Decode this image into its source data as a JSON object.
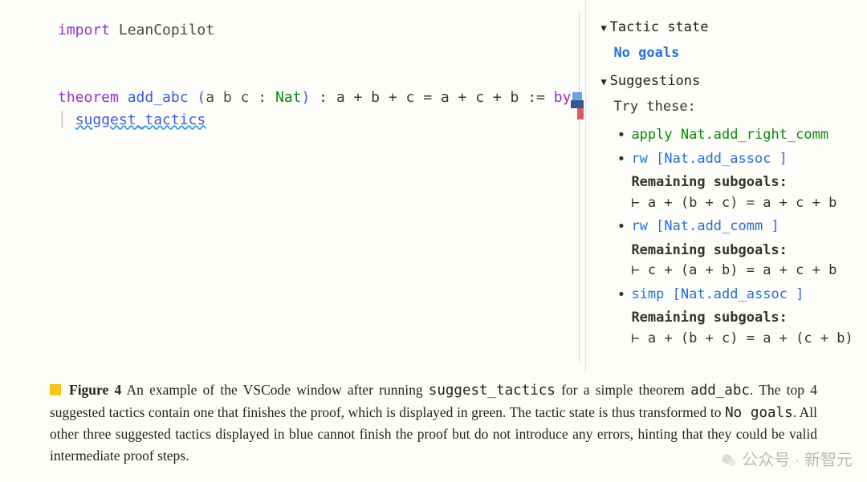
{
  "editor": {
    "line1": {
      "kw": "import",
      "module": "LeanCopilot"
    },
    "line2": {
      "kw": "theorem",
      "name": "add_abc",
      "params_open": "(",
      "params": "a b c",
      "colon1": " : ",
      "type": "Nat",
      "params_close": ")",
      "sig": " : a + b + c = a + c + b := ",
      "by": "by"
    },
    "line3": {
      "bar": "│ ",
      "tactic": "suggest_tactics"
    }
  },
  "sidebar": {
    "tactic_state_title": "Tactic state",
    "no_goals": "No goals",
    "suggestions_title": "Suggestions",
    "try_these": "Try these:",
    "suggestions": [
      {
        "tactic_apply": "apply",
        "tactic_args": "  Nat.add_right_comm",
        "kind": "green"
      },
      {
        "tactic_apply": "rw",
        "tactic_args": " [Nat.add_assoc ]",
        "kind": "blue",
        "subhead": "Remaining subgoals:",
        "subgoal": "⊢ a + (b + c) = a + c + b"
      },
      {
        "tactic_apply": "rw",
        "tactic_args": " [Nat.add_comm ]",
        "kind": "blue",
        "subhead": "Remaining subgoals:",
        "subgoal": "⊢ c + (a + b) = a + c + b"
      },
      {
        "tactic_apply": "simp",
        "tactic_args": " [Nat.add_assoc ]",
        "kind": "blue",
        "subhead": "Remaining subgoals:",
        "subgoal": "⊢ a + (b + c) = a + (c + b)"
      }
    ]
  },
  "caption": {
    "label": "Figure 4",
    "t1": " An example of the VSCode window after running ",
    "c1": "suggest_tactics",
    "t2": " for a simple theorem ",
    "c2": "add_abc",
    "t3": ". The top 4 suggested tactics contain one that finishes the proof, which is displayed in green. The tactic state is thus transformed to ",
    "c3": "No goals",
    "t4": ". All other three suggested tactics displayed in blue cannot finish the proof but do not introduce any errors, hinting that they could be valid intermediate proof steps."
  },
  "watermark": {
    "text": "公众号 · 新智元"
  }
}
